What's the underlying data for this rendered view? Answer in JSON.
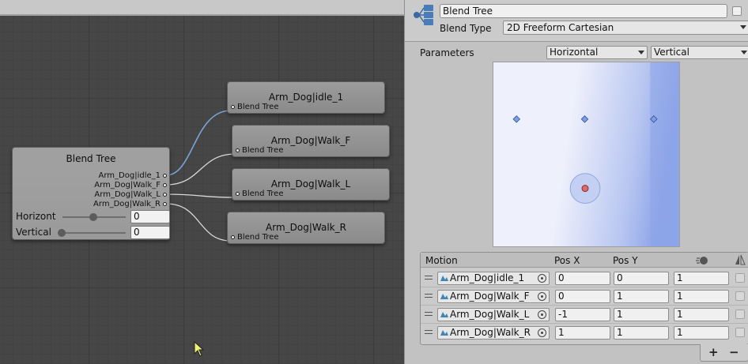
{
  "graph": {
    "blend_node": {
      "title": "Blend Tree",
      "outputs": [
        "Arm_Dog|idle_1",
        "Arm_Dog|Walk_F",
        "Arm_Dog|Walk_L",
        "Arm_Dog|Walk_R"
      ],
      "params": [
        {
          "name": "Horizont",
          "value": "0"
        },
        {
          "name": "Vertical",
          "value": "0"
        }
      ]
    },
    "child_nodes": [
      {
        "title": "Arm_Dog|idle_1",
        "input": "Blend Tree"
      },
      {
        "title": "Arm_Dog|Walk_F",
        "input": "Blend Tree"
      },
      {
        "title": "Arm_Dog|Walk_L",
        "input": "Blend Tree"
      },
      {
        "title": "Arm_Dog|Walk_R",
        "input": "Blend Tree"
      }
    ]
  },
  "inspector": {
    "name": "Blend Tree",
    "blend_type_label": "Blend Type",
    "blend_type": "2D Freeform Cartesian",
    "parameters_label": "Parameters",
    "param_x": "Horizontal",
    "param_y": "Vertical",
    "motion_list": {
      "headers": {
        "motion": "Motion",
        "pos_x": "Pos X",
        "pos_y": "Pos Y"
      },
      "rows": [
        {
          "motion": "Arm_Dog|idle_1",
          "pos_x": "0",
          "pos_y": "0",
          "speed": "1"
        },
        {
          "motion": "Arm_Dog|Walk_F",
          "pos_x": "0",
          "pos_y": "1",
          "speed": "1"
        },
        {
          "motion": "Arm_Dog|Walk_L",
          "pos_x": "-1",
          "pos_y": "1",
          "speed": "1"
        },
        {
          "motion": "Arm_Dog|Walk_R",
          "pos_x": "1",
          "pos_y": "1",
          "speed": "1"
        }
      ]
    },
    "footer": {
      "add": "+",
      "remove": "−"
    }
  },
  "colors": {
    "wire_active": "#7aa4d6",
    "wire": "#d8d8d8",
    "motion_point": "#7d9ee6",
    "current_point": "#e06a6a",
    "blend_area": "#8da4e8"
  },
  "icons": [
    "blend-tree-icon",
    "animation-clip-icon",
    "object-picker-icon",
    "speed-icon",
    "mirror-icon",
    "mouse-cursor-icon",
    "drag-handle-icon"
  ]
}
